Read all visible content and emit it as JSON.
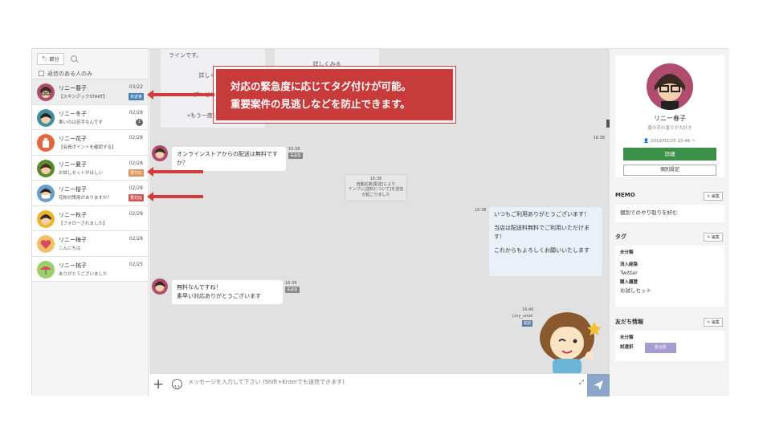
{
  "left": {
    "tag_button": "節分",
    "filter_label": "返信のある人のみ",
    "users": [
      {
        "name": "リニー春子",
        "msg": "【スキンデックSTART】",
        "date": "03/22",
        "badge": "未返答",
        "badge_color": "#4a7fb8",
        "selected": true
      },
      {
        "name": "リニー冬子",
        "msg": "寒いのは苦手なんです",
        "date": "02/28",
        "count": "1"
      },
      {
        "name": "リニー花子",
        "msg": "【会員ポイントを確認する】",
        "date": "02/28"
      },
      {
        "name": "リニー夏子",
        "msg": "お試しセットがほしい",
        "date": "02/28",
        "badge": "要対応",
        "badge_color": "#d9925a"
      },
      {
        "name": "リニー桜子",
        "msg": "花粉対策用がありますか？",
        "date": "02/28",
        "badge": "要対応",
        "badge_color": "#cc5555"
      },
      {
        "name": "リニー秋子",
        "msg": "【フォローされました】",
        "date": "02/28"
      },
      {
        "name": "リニー梅子",
        "msg": "こんにちは",
        "date": "02/28"
      },
      {
        "name": "リニー桃子",
        "msg": "ありがとうございました",
        "date": "02/25"
      }
    ]
  },
  "chat": {
    "card1_text": "ラインです。",
    "card1_link": "詳しくみる",
    "card1_link2": "プレゼント応募",
    "card1_more": "»もう一度返信する«",
    "card2_link": "詳しくみる",
    "time_top": "16:38",
    "msg1": {
      "text1": "オンラインストアからの配送は無料です",
      "text2": "か？",
      "time": "16:38",
      "badge": "未返答"
    },
    "system": {
      "time": "16:38",
      "line1": "自動応答[配送]により",
      "line2": "テンプレ[送料について]を送信",
      "line3": "が起こりました"
    },
    "reply": {
      "time": "16:38",
      "line1": "いつもご利用ありがとうございます！",
      "line2": "当店は配送料無料でご利用いただけま",
      "line3": "す！",
      "line4": "これからもよろしくお願いいたします"
    },
    "msg2": {
      "text1": "無料なんですね！",
      "text2": "素早い対応ありがとうございます",
      "time": "16:39",
      "badge": "未返答"
    },
    "sticker": {
      "time": "16:40",
      "sender": "Liny_umei",
      "badge": "既読"
    },
    "input_placeholder": "メッセージを入力して下さい (Shift+Enterでも送信できます)"
  },
  "profile": {
    "name": "リニー春子",
    "status": "夏の花の香りが大好き",
    "date": "2019/02/25 15:46 〜",
    "detail_button": "詳細",
    "individual_button": "個別設定",
    "memo_title": "MEMO",
    "memo_text": "個別でのやり取りを好む",
    "tag_title": "タグ",
    "tag_cat1": "未分類",
    "tag_cat2": "流入経路",
    "tag_val2": "Twitter",
    "tag_cat3": "購入履歴",
    "tag_val3": "お試しセット",
    "friend_title": "友だち情報",
    "friend_cat": "未分類",
    "friend_label": "試選択",
    "friend_tag": "混合肌",
    "edit_label": "編集"
  },
  "annotation": {
    "line1": "対応の緊急度に応じてタグ付けが可能。",
    "line2": "重要案件の見逃しなどを防止できます。"
  }
}
